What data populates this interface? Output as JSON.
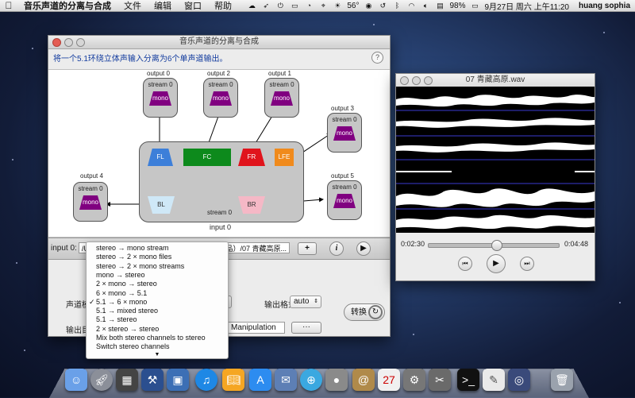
{
  "menubar": {
    "apple": "",
    "app_name": "音乐声道的分离与合成",
    "items": [
      "文件",
      "编辑",
      "窗口",
      "帮助"
    ],
    "temperature": "56°",
    "battery": "98%",
    "datetime": "9月27日 周六 上午11:20",
    "user": "huang sophia"
  },
  "main_window": {
    "title": "音乐声道的分离与合成",
    "description": "将一个5.1环绕立体声输入分离为6个单声道输出。",
    "help": "?",
    "outputs": [
      {
        "label": "output 0",
        "stream": "stream 0",
        "box": "mono"
      },
      {
        "label": "output 2",
        "stream": "stream 0",
        "box": "mono"
      },
      {
        "label": "output 1",
        "stream": "stream 0",
        "box": "mono"
      },
      {
        "label": "output 3",
        "stream": "stream 0",
        "box": "mono"
      },
      {
        "label": "output 4",
        "stream": "stream 0",
        "box": "mono"
      },
      {
        "label": "output 5",
        "stream": "stream 0",
        "box": "mono"
      }
    ],
    "channels": {
      "FL": "FL",
      "FC": "FC",
      "FR": "FR",
      "LFE": "LFE",
      "BL": "BL",
      "BR": "BR"
    },
    "input_node": {
      "stream": "stream 0",
      "label": "input 0"
    },
    "input_bar": {
      "label": "input 0:",
      "path_prefix": "/U",
      "path_suffix": "非卖品）/07 青藏高原...",
      "add": "+",
      "info": "i"
    },
    "lower": {
      "mode_label": "声道模式",
      "format_label": "输出格式:",
      "format_value": "auto",
      "output_dir_label": "输出目录",
      "output_dir_value": "Manipulation",
      "browse": "···",
      "convert": "转换"
    }
  },
  "popup_menu": {
    "items": [
      "stereo → mono stream",
      "stereo → 2 × mono files",
      "stereo → 2 × mono streams",
      "mono → stereo",
      "2 × mono → stereo",
      "6 × mono → 5.1",
      "5.1 → 6 × mono",
      "5.1 → mixed stereo",
      "5.1 → stereo",
      "2 × stereo → stereo",
      "Mix both stereo channels to stereo",
      "Switch stereo channels"
    ],
    "checked_index": 6,
    "more": "▼"
  },
  "audio_window": {
    "title": "07 青藏高原.wav",
    "elapsed": "0:02:30",
    "total": "0:04:48",
    "progress": 0.52
  },
  "colors": {
    "accent_text": "#123b9e",
    "mono": "#800080",
    "FL": "#3d7fd9",
    "FC": "#0d8a1c",
    "FR": "#e0141c",
    "LFE": "#f08a1c",
    "BL": "#cfe8f7",
    "BR": "#f5b8c6"
  }
}
